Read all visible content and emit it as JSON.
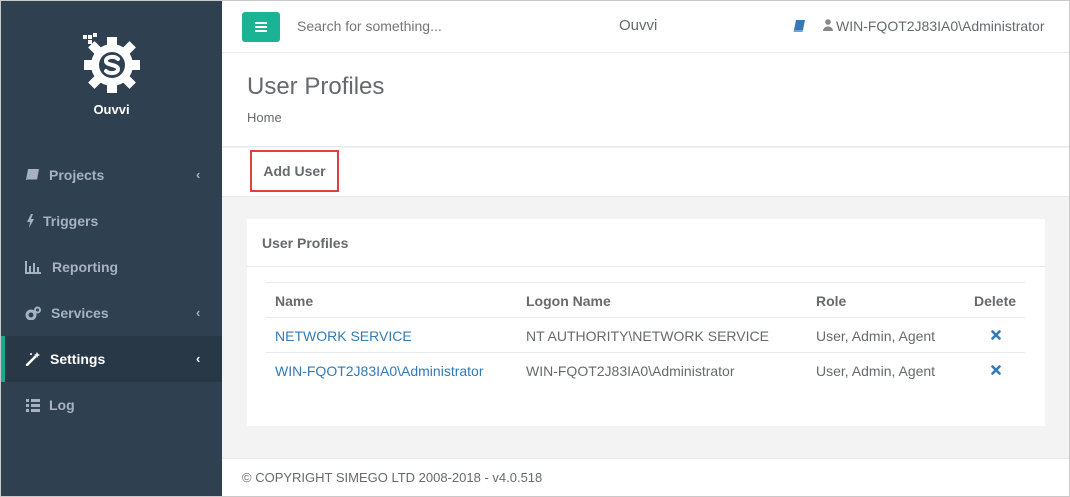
{
  "app": {
    "name": "Ouvvi"
  },
  "sidebar": {
    "items": [
      {
        "label": "Projects",
        "icon": "book-icon",
        "has_chevron": true
      },
      {
        "label": "Triggers",
        "icon": "bolt-icon",
        "has_chevron": false
      },
      {
        "label": "Reporting",
        "icon": "bar-chart-icon",
        "has_chevron": false
      },
      {
        "label": "Services",
        "icon": "gears-icon",
        "has_chevron": true
      },
      {
        "label": "Settings",
        "icon": "magic-wand-icon",
        "has_chevron": true,
        "active": true
      },
      {
        "label": "Log",
        "icon": "list-icon",
        "has_chevron": false
      }
    ],
    "chevron": "‹"
  },
  "topbar": {
    "search_placeholder": "Search for something...",
    "title": "Ouvvi",
    "user": "WIN-FQOT2J83IA0\\Administrator"
  },
  "page": {
    "title": "User Profiles",
    "breadcrumb": "Home"
  },
  "toolbar": {
    "add_user_label": "Add User"
  },
  "panel": {
    "title": "User Profiles",
    "columns": [
      "Name",
      "Logon Name",
      "Role",
      "Delete"
    ],
    "rows": [
      {
        "name": "NETWORK SERVICE",
        "logon": "NT AUTHORITY\\NETWORK SERVICE",
        "role": "User, Admin, Agent"
      },
      {
        "name": "WIN-FQOT2J83IA0\\Administrator",
        "logon": "WIN-FQOT2J83IA0\\Administrator",
        "role": "User, Admin, Agent"
      }
    ]
  },
  "footer": {
    "text": "© COPYRIGHT SIMEGO LTD 2008-2018 - v4.0.518"
  },
  "colors": {
    "sidebar_bg": "#2f4050",
    "sidebar_active_bg": "#293846",
    "accent": "#1ab394",
    "link": "#337ab7",
    "highlight_border": "#e2403e"
  }
}
